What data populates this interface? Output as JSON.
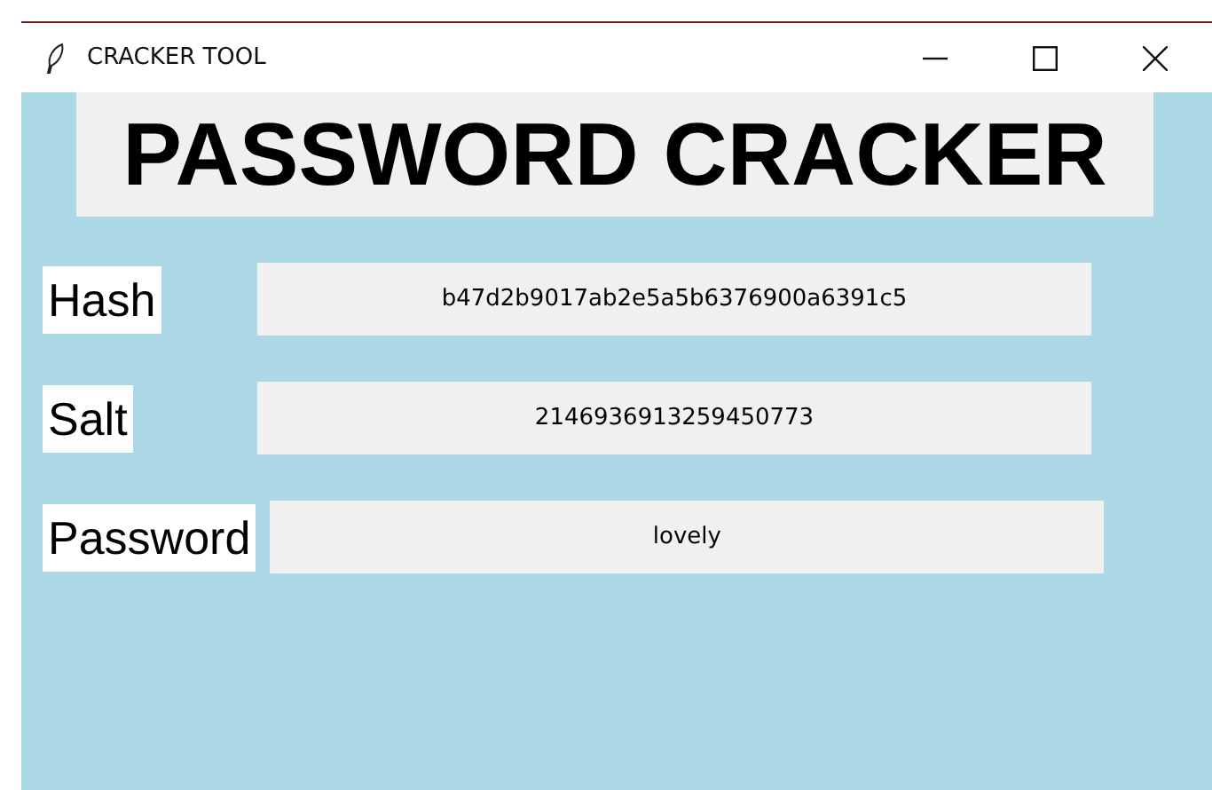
{
  "window": {
    "title": "CRACKER TOOL"
  },
  "heading": "PASSWORD CRACKER",
  "fields": [
    {
      "label": "Hash",
      "value": "b47d2b9017ab2e5a5b6376900a6391c5"
    },
    {
      "label": "Salt",
      "value": "2146936913259450773"
    },
    {
      "label": "Password",
      "value": "lovely"
    }
  ]
}
